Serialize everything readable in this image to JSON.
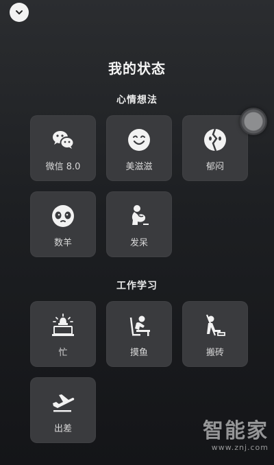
{
  "header": {
    "title": "我的状态",
    "collapse_icon": "chevron-down-icon"
  },
  "sections": [
    {
      "title": "心情想法",
      "items": [
        {
          "label": "微信 8.0",
          "icon": "wechat-icon"
        },
        {
          "label": "美滋滋",
          "icon": "smile-face-icon"
        },
        {
          "label": "郁闷",
          "icon": "broken-heart-face-icon"
        },
        {
          "label": "数羊",
          "icon": "sheep-face-icon"
        },
        {
          "label": "发呆",
          "icon": "daze-person-icon"
        }
      ]
    },
    {
      "title": "工作学习",
      "items": [
        {
          "label": "忙",
          "icon": "siren-laptop-icon"
        },
        {
          "label": "摸鱼",
          "icon": "slacking-desk-icon"
        },
        {
          "label": "搬砖",
          "icon": "hammer-worker-icon"
        },
        {
          "label": "出差",
          "icon": "airplane-icon"
        }
      ]
    }
  ],
  "watermark": {
    "logo": "智能家",
    "url": "www.znj.com"
  },
  "colors": {
    "background": "#1d1f22",
    "tile": "#3a3b3e",
    "text": "#ffffff"
  }
}
